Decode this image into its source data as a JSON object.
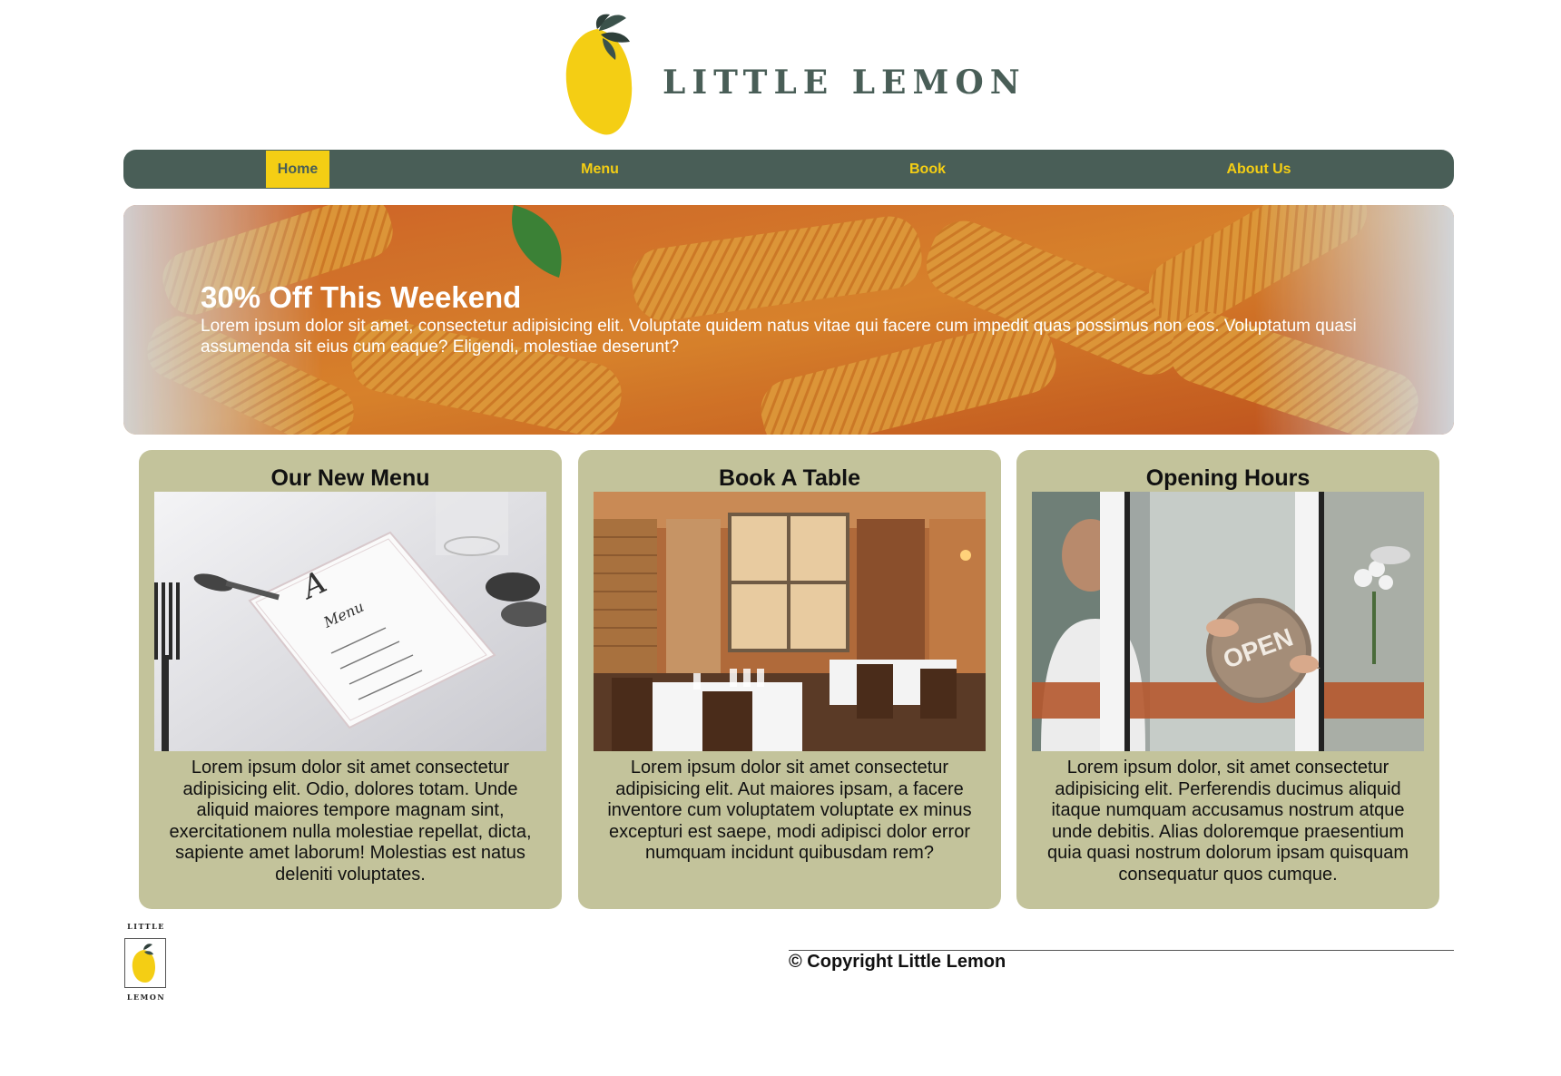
{
  "brand": {
    "name": "LITTLE LEMON",
    "footer_logo_top": "LITTLE",
    "footer_logo_bottom": "LEMON"
  },
  "colors": {
    "primary_green": "#495e57",
    "primary_yellow": "#f4ce14",
    "card_background": "#c3c39b"
  },
  "nav": {
    "items": [
      {
        "label": "Home",
        "active": true
      },
      {
        "label": "Menu",
        "active": false
      },
      {
        "label": "Book",
        "active": false
      },
      {
        "label": "About Us",
        "active": false
      }
    ]
  },
  "hero": {
    "title": "30% Off This Weekend",
    "text": "Lorem ipsum dolor sit amet, consectetur adipisicing elit. Voluptate quidem natus vitae qui facere cum impedit quas possimus non eos. Voluptatum quasi assumenda sit eius cum eaque? Eligendi, molestiae deserunt?"
  },
  "cards": [
    {
      "title": "Our New Menu",
      "text": "Lorem ipsum dolor sit amet consectetur adipisicing elit. Odio, dolores totam. Unde aliquid maiores tempore magnam sint, exercitationem nulla molestiae repellat, dicta, sapiente amet laborum! Molestias est natus deleniti voluptates."
    },
    {
      "title": "Book A Table",
      "text": "Lorem ipsum dolor sit amet consectetur adipisicing elit. Aut maiores ipsam, a facere inventore cum voluptatem voluptate ex minus excepturi est saepe, modi adipisci dolor error numquam incidunt quibusdam rem?"
    },
    {
      "title": "Opening Hours",
      "text": "Lorem ipsum dolor, sit amet consectetur adipisicing elit. Perferendis ducimus aliquid itaque numquam accusamus nostrum atque unde debitis. Alias doloremque praesentium quia quasi nostrum dolorum ipsam quisquam consequatur quos cumque."
    }
  ],
  "images": {
    "logo": "lemon-icon",
    "hero": "pasta-photo",
    "menu_card": "menu-card-photo",
    "book_card": "restaurant-interior-photo",
    "hours_card": "open-sign-photo",
    "open_sign_text": "OPEN"
  },
  "footer": {
    "copyright": "© Copyright Little Lemon"
  }
}
